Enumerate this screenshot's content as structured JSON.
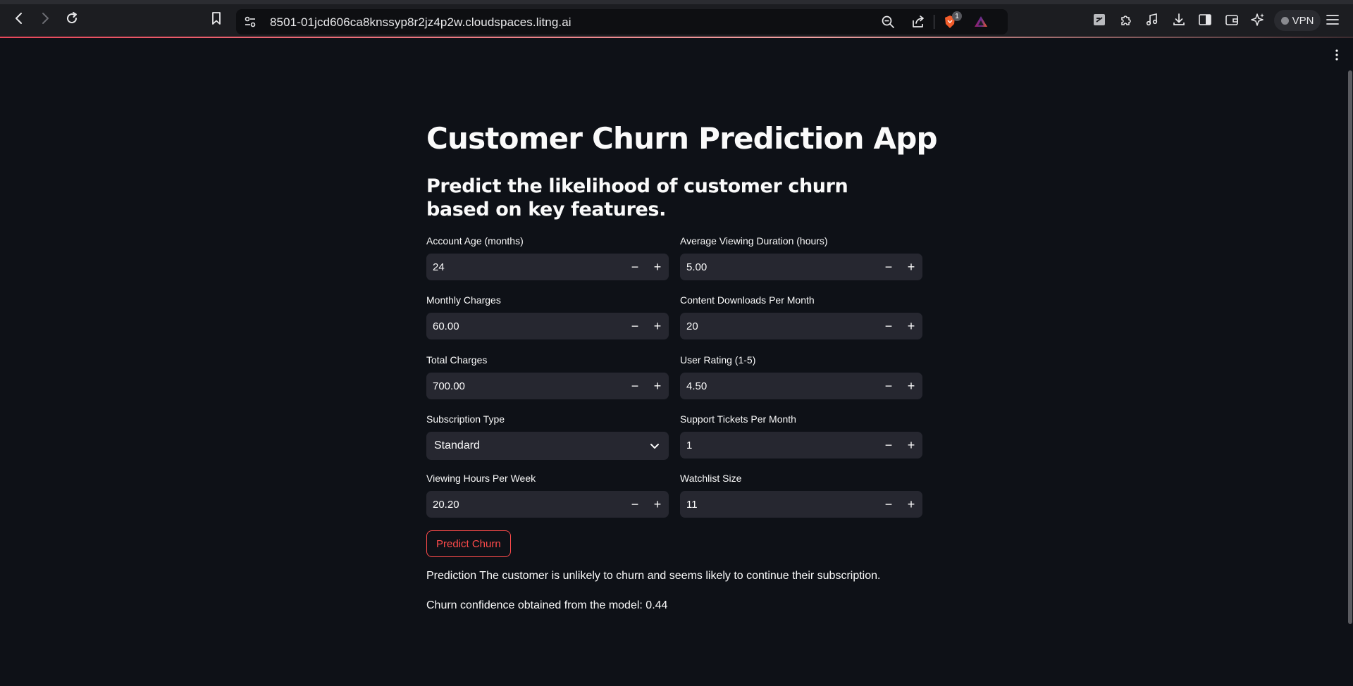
{
  "browser": {
    "url": "8501-01jcd606ca8knssyp8r2jz4p2w.cloudspaces.litng.ai",
    "brave_badge_count": "1",
    "vpn_label": "VPN",
    "icons": [
      "back-icon",
      "forward-icon",
      "reload-icon",
      "bookmark-icon",
      "site-info-icon",
      "zoom-icon",
      "share-icon",
      "brave-shields-icon",
      "rewards-icon",
      "extension-icon",
      "puzzle-icon",
      "music-icon",
      "download-icon",
      "sidebar-icon",
      "wallet-icon",
      "leo-ai-icon",
      "menu-icon"
    ]
  },
  "app": {
    "title": "Customer Churn Prediction App",
    "subtitle": "Predict the likelihood of customer churn based on key features.",
    "fields": {
      "account_age": {
        "label": "Account Age (months)",
        "value": "24"
      },
      "avg_viewing_duration": {
        "label": "Average Viewing Duration (hours)",
        "value": "5.00"
      },
      "monthly_charges": {
        "label": "Monthly Charges",
        "value": "60.00"
      },
      "content_downloads": {
        "label": "Content Downloads Per Month",
        "value": "20"
      },
      "total_charges": {
        "label": "Total Charges",
        "value": "700.00"
      },
      "user_rating": {
        "label": "User Rating (1-5)",
        "value": "4.50"
      },
      "subscription_type": {
        "label": "Subscription Type",
        "value": "Standard"
      },
      "support_tickets": {
        "label": "Support Tickets Per Month",
        "value": "1"
      },
      "viewing_hours": {
        "label": "Viewing Hours Per Week",
        "value": "20.20"
      },
      "watchlist_size": {
        "label": "Watchlist Size",
        "value": "11"
      }
    },
    "stepper": {
      "minus": "−",
      "plus": "+"
    },
    "predict_button": "Predict Churn",
    "prediction_text": "Prediction The customer is unlikely to churn and seems likely to continue their subscription.",
    "confidence_text": "Churn confidence obtained from the model: 0.44"
  },
  "colors": {
    "background": "#0e1117",
    "input_bg": "#262730",
    "accent": "#ff4b4b",
    "chrome_bg": "#1c1d21"
  }
}
